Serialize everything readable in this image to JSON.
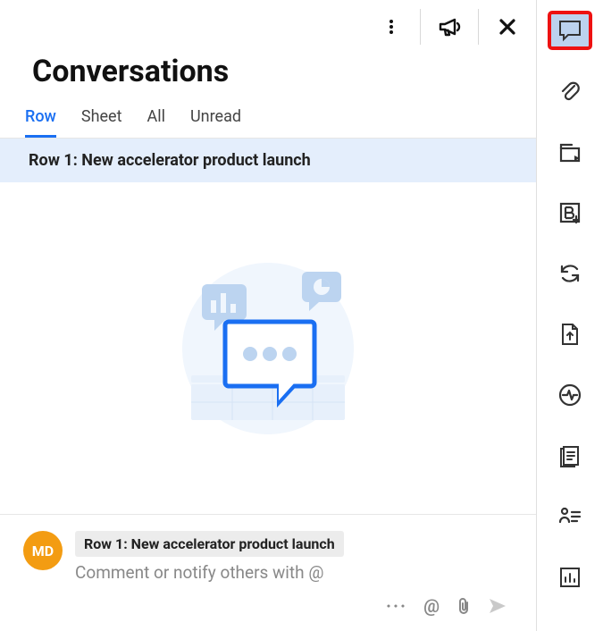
{
  "header": {
    "title": "Conversations"
  },
  "tabs": [
    {
      "label": "Row",
      "active": true
    },
    {
      "label": "Sheet",
      "active": false
    },
    {
      "label": "All",
      "active": false
    },
    {
      "label": "Unread",
      "active": false
    }
  ],
  "selected_row_banner": "Row 1: New accelerator product launch",
  "composer": {
    "avatar_initials": "MD",
    "reference_pill": "Row 1: New accelerator product launch",
    "placeholder": "Comment or notify others with @"
  },
  "composer_tools": {
    "more": "···",
    "mention": "@"
  },
  "colors": {
    "accent": "#1a6ff2",
    "avatar": "#f39c12",
    "highlight_border": "#e11"
  }
}
